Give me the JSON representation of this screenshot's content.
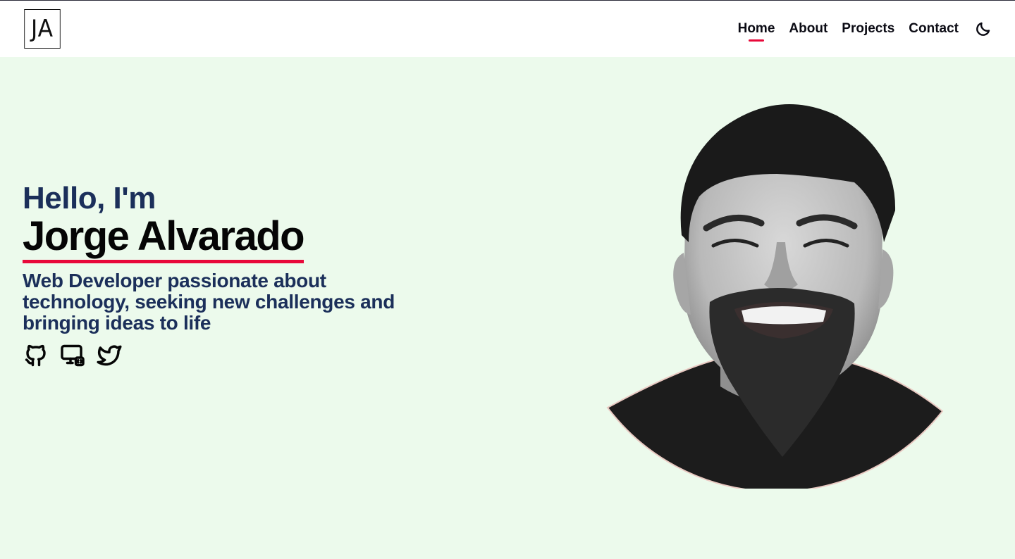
{
  "header": {
    "logo_text": "JA",
    "nav": [
      {
        "label": "Home",
        "active": true
      },
      {
        "label": "About",
        "active": false
      },
      {
        "label": "Projects",
        "active": false
      },
      {
        "label": "Contact",
        "active": false
      }
    ],
    "theme_toggle_icon": "moon-icon"
  },
  "hero": {
    "greeting": "Hello, I'm",
    "name": "Jorge Alvarado",
    "tagline": "Web Developer passionate about technology, seeking new challenges and bringing ideas to life",
    "socials": [
      {
        "icon": "github-icon"
      },
      {
        "icon": "portfolio-devices-icon"
      },
      {
        "icon": "twitter-icon"
      }
    ],
    "portrait": "profile-photo"
  },
  "colors": {
    "accent": "#e8093a",
    "heading_navy": "#1b2f5a",
    "hero_background": "#ecfaec",
    "header_background": "#ffffff",
    "text_dark": "#050505"
  }
}
